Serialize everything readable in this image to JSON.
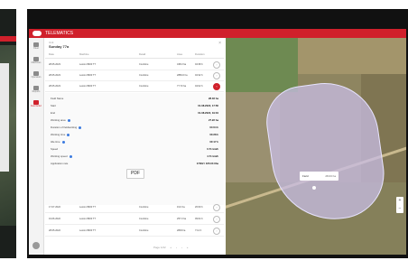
{
  "app": {
    "title": "TELEMATICS"
  },
  "sidebar": {
    "items": [
      {
        "label": "Fleet",
        "icon": "home-icon"
      },
      {
        "label": "Machines",
        "icon": "tractor-icon"
      },
      {
        "label": "Operators",
        "icon": "user-icon"
      },
      {
        "label": "Reports",
        "icon": "document-icon"
      },
      {
        "label": "Field Activities",
        "icon": "field-icon",
        "active": true
      }
    ]
  },
  "panel": {
    "breadcrumb": "Unit",
    "unit_name": "Sunday 77a",
    "columns": [
      "Date",
      "Machine",
      "Detail",
      "Area",
      "Duration"
    ],
    "rows_top": [
      [
        "28.05.2023",
        "Lexion 8900 TT",
        "Combine",
        "348.0 ha",
        "04:38 h"
      ],
      [
        "28.05.2023",
        "Lexion 8900 TT",
        "Combine",
        "2883.0 ha",
        "04:32 h"
      ],
      [
        "28.05.2023",
        "Lexion 8900 TT",
        "Combine",
        "77.73 ha",
        "04:02 h"
      ]
    ],
    "details": [
      {
        "key": "Field Name",
        "value": "28.03 ha",
        "info": false
      },
      {
        "key": "Start",
        "value": "01.08.2022, 17:56",
        "info": false
      },
      {
        "key": "End",
        "value": "01.08.2022, 19:04",
        "info": false
      },
      {
        "key": "Working area",
        "value": "27.22 ha",
        "info": true
      },
      {
        "key": "Duration of fieldworking",
        "value": "04:04 h",
        "info": true
      },
      {
        "key": "Working time",
        "value": "03:28 h",
        "info": true
      },
      {
        "key": "Idle time",
        "value": "00:17 h",
        "info": true
      },
      {
        "key": "Speed",
        "value": "0.71 km/h",
        "info": false
      },
      {
        "key": "Working speed",
        "value": "4.71 km/h",
        "info": true
      },
      {
        "key": "Application rate",
        "value": "17302 / 165.03 l/ha",
        "info": false
      }
    ],
    "report_button": "PDF",
    "rows_bottom": [
      [
        "17.07.2022",
        "Lexion 8900 TT",
        "Combine",
        "19.0 ha",
        "20:09 h"
      ],
      [
        "19.06.2022",
        "Lexion 8900 TT",
        "Combine",
        "257.0 ha",
        "09:04 h"
      ],
      [
        "28.05.2022",
        "Lexion 8900 TT",
        "Combine",
        "2803 ha",
        "7:12 h"
      ]
    ],
    "pager": {
      "label": "Page 1/22",
      "buttons": [
        "«",
        "‹",
        "›",
        "»"
      ]
    }
  },
  "map": {
    "popup_label": "Field",
    "popup_value": "28.03 ha",
    "zoom_in": "+",
    "zoom_out": "−"
  }
}
